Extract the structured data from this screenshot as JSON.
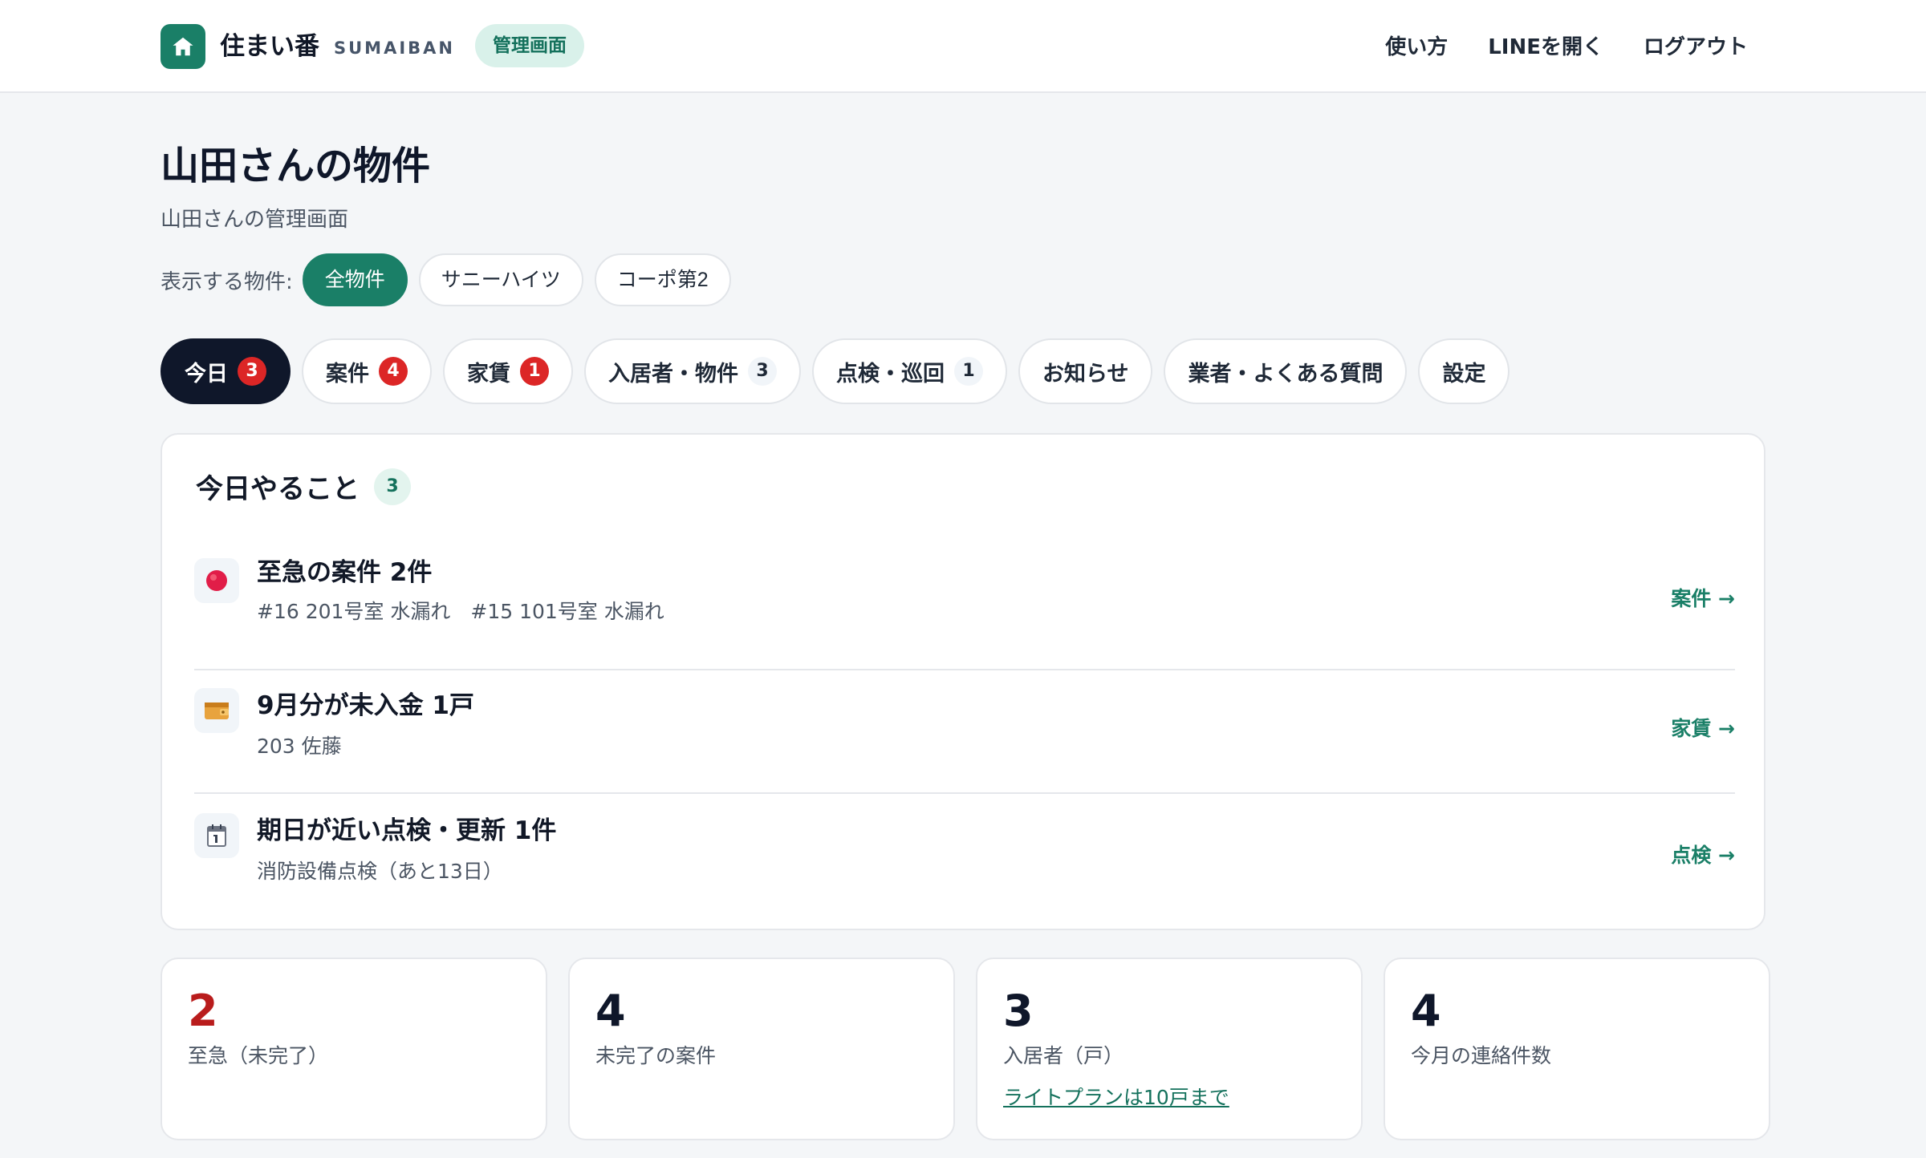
{
  "header": {
    "brand_name": "住まい番",
    "brand_sub": "SUMAIBAN",
    "admin_label": "管理画面",
    "nav": [
      "使い方",
      "LINEを開く",
      "ログアウト"
    ]
  },
  "page": {
    "title": "山田さんの物件",
    "subtitle": "山田さんの管理画面"
  },
  "filter": {
    "label": "表示する物件:",
    "options": [
      "全物件",
      "サニーハイツ",
      "コーポ第2"
    ],
    "selected": "全物件"
  },
  "tabs": [
    {
      "label": "今日",
      "count": "3",
      "alert": true,
      "active": true
    },
    {
      "label": "案件",
      "count": "4",
      "alert": true,
      "active": false
    },
    {
      "label": "家賃",
      "count": "1",
      "alert": true,
      "active": false
    },
    {
      "label": "入居者・物件",
      "count": "3",
      "alert": false,
      "active": false
    },
    {
      "label": "点検・巡回",
      "count": "1",
      "alert": false,
      "active": false
    },
    {
      "label": "お知らせ",
      "active": false
    },
    {
      "label": "業者・よくある質問",
      "active": false
    },
    {
      "label": "設定",
      "active": false
    }
  ],
  "today": {
    "title": "今日やること",
    "count": "3",
    "tasks": [
      {
        "icon": "red-circle-icon",
        "title": "至急の案件 2件",
        "detail": "#16 201号室 水漏れ　#15 101号室 水漏れ",
        "link": "案件 →"
      },
      {
        "icon": "wallet-icon",
        "title": "9月分が未入金 1戸",
        "detail": "203 佐藤",
        "link": "家賃 →"
      },
      {
        "icon": "calendar-icon",
        "title": "期日が近い点検・更新 1件",
        "detail": "消防設備点検（あと13日）",
        "link": "点検 →"
      }
    ]
  },
  "stats": [
    {
      "value": "2",
      "label": "至急（未完了）",
      "urgent": true
    },
    {
      "value": "4",
      "label": "未完了の案件"
    },
    {
      "value": "3",
      "label": "入居者（戸）",
      "link": "ライトプランは10戸まで"
    },
    {
      "value": "4",
      "label": "今月の連絡件数"
    }
  ],
  "colors": {
    "accent": "#1a7f67",
    "urgent": "#dc2626",
    "dark": "#0f172a"
  }
}
